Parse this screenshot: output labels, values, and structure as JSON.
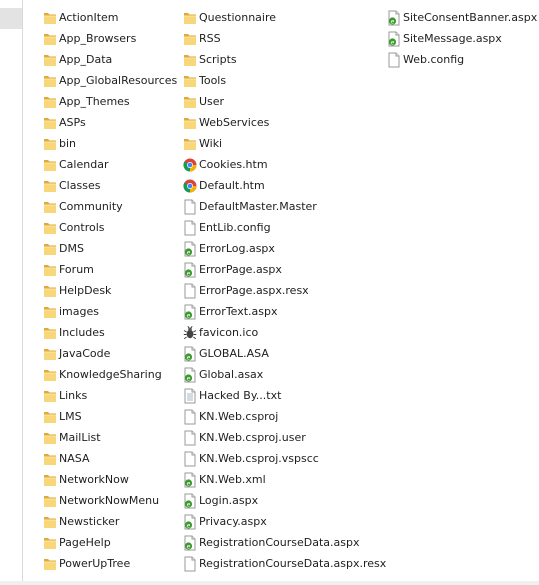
{
  "columns": [
    [
      {
        "name": "ActionItem",
        "icon": "folder-icon"
      },
      {
        "name": "App_Browsers",
        "icon": "folder-icon"
      },
      {
        "name": "App_Data",
        "icon": "folder-icon"
      },
      {
        "name": "App_GlobalResources",
        "icon": "folder-icon"
      },
      {
        "name": "App_Themes",
        "icon": "folder-icon"
      },
      {
        "name": "ASPs",
        "icon": "folder-icon"
      },
      {
        "name": "bin",
        "icon": "folder-icon"
      },
      {
        "name": "Calendar",
        "icon": "folder-icon"
      },
      {
        "name": "Classes",
        "icon": "folder-icon"
      },
      {
        "name": "Community",
        "icon": "folder-icon"
      },
      {
        "name": "Controls",
        "icon": "folder-icon"
      },
      {
        "name": "DMS",
        "icon": "folder-icon"
      },
      {
        "name": "Forum",
        "icon": "folder-icon"
      },
      {
        "name": "HelpDesk",
        "icon": "folder-icon"
      },
      {
        "name": "images",
        "icon": "folder-icon"
      },
      {
        "name": "Includes",
        "icon": "folder-icon"
      },
      {
        "name": "JavaCode",
        "icon": "folder-icon"
      },
      {
        "name": "KnowledgeSharing",
        "icon": "folder-icon"
      },
      {
        "name": "Links",
        "icon": "folder-icon"
      },
      {
        "name": "LMS",
        "icon": "folder-icon"
      },
      {
        "name": "MailList",
        "icon": "folder-icon"
      },
      {
        "name": "NASA",
        "icon": "folder-icon"
      },
      {
        "name": "NetworkNow",
        "icon": "folder-icon"
      },
      {
        "name": "NetworkNowMenu",
        "icon": "folder-icon"
      },
      {
        "name": "Newsticker",
        "icon": "folder-icon"
      },
      {
        "name": "PageHelp",
        "icon": "folder-icon"
      },
      {
        "name": "PowerUpTree",
        "icon": "folder-icon"
      }
    ],
    [
      {
        "name": "Questionnaire",
        "icon": "folder-icon"
      },
      {
        "name": "RSS",
        "icon": "folder-icon"
      },
      {
        "name": "Scripts",
        "icon": "folder-icon"
      },
      {
        "name": "Tools",
        "icon": "folder-icon"
      },
      {
        "name": "User",
        "icon": "folder-icon"
      },
      {
        "name": "WebServices",
        "icon": "folder-icon"
      },
      {
        "name": "Wiki",
        "icon": "folder-icon"
      },
      {
        "name": "Cookies.htm",
        "icon": "chrome-icon"
      },
      {
        "name": "Default.htm",
        "icon": "chrome-icon"
      },
      {
        "name": "DefaultMaster.Master",
        "icon": "blank-file-icon"
      },
      {
        "name": "EntLib.config",
        "icon": "blank-file-icon"
      },
      {
        "name": "ErrorLog.aspx",
        "icon": "aspx-file-icon"
      },
      {
        "name": "ErrorPage.aspx",
        "icon": "aspx-file-icon"
      },
      {
        "name": "ErrorPage.aspx.resx",
        "icon": "blank-file-icon"
      },
      {
        "name": "ErrorText.aspx",
        "icon": "aspx-file-icon"
      },
      {
        "name": "favicon.ico",
        "icon": "bug-icon"
      },
      {
        "name": "GLOBAL.ASA",
        "icon": "aspx-file-icon"
      },
      {
        "name": "Global.asax",
        "icon": "aspx-file-icon"
      },
      {
        "name": "Hacked By...txt",
        "icon": "text-file-icon"
      },
      {
        "name": "KN.Web.csproj",
        "icon": "blank-file-icon"
      },
      {
        "name": "KN.Web.csproj.user",
        "icon": "blank-file-icon"
      },
      {
        "name": "KN.Web.csproj.vspscc",
        "icon": "blank-file-icon"
      },
      {
        "name": "KN.Web.xml",
        "icon": "aspx-file-icon"
      },
      {
        "name": "Login.aspx",
        "icon": "aspx-file-icon"
      },
      {
        "name": "Privacy.aspx",
        "icon": "aspx-file-icon"
      },
      {
        "name": "RegistrationCourseData.aspx",
        "icon": "aspx-file-icon"
      },
      {
        "name": "RegistrationCourseData.aspx.resx",
        "icon": "blank-file-icon"
      }
    ],
    [
      {
        "name": "SiteConsentBanner.aspx",
        "icon": "aspx-file-icon"
      },
      {
        "name": "SiteMessage.aspx",
        "icon": "aspx-file-icon"
      },
      {
        "name": "Web.config",
        "icon": "blank-file-icon"
      }
    ]
  ]
}
